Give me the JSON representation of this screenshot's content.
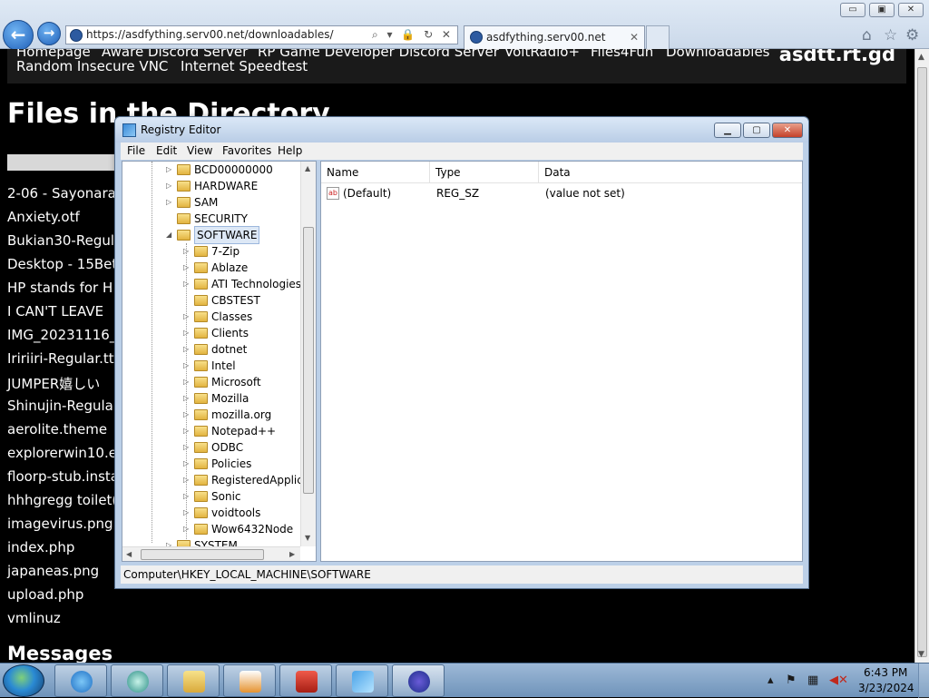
{
  "browser": {
    "url": "https://asdfything.serv00.net/downloadables/",
    "tab_title": "asdfything.serv00.net",
    "window_controls": {
      "minimize": "▭",
      "maximize": "▣",
      "close": "✕"
    },
    "back_icon": "back-arrow-icon",
    "forward_icon": "forward-arrow-icon"
  },
  "site": {
    "nav_row1": [
      "Homepage",
      "Aware Discord Server",
      "RP Game Developer Discord Server",
      "VoltRadio+",
      "Files4Fun",
      "Downloadables"
    ],
    "nav_row2": [
      "Random Insecure VNC",
      "Internet Speedtest"
    ],
    "brand": "asdtt.rt.gd",
    "heading": "Files in the Directory",
    "files": [
      "2-06 - Sayonara",
      "Anxiety.otf",
      "Bukian30-Regula",
      "Desktop - 15Bett",
      "HP stands for H",
      "I CAN'T LEAVE",
      "IMG_20231116_1",
      "Iririiri-Regular.tt",
      "JUMPER嬉しい",
      "Shinujin-Regular",
      "aerolite.theme",
      "explorerwin10.ex",
      "floorp-stub.insta",
      "hhhgregg toilet(",
      "imagevirus.png",
      "index.php",
      "japaneas.png",
      "upload.php",
      "vmlinuz"
    ],
    "messages_heading": "Messages"
  },
  "regedit": {
    "title": "Registry Editor",
    "menu": [
      "File",
      "Edit",
      "View",
      "Favorites",
      "Help"
    ],
    "tree_root": [
      "BCD00000000",
      "HARDWARE",
      "SAM",
      "SECURITY",
      "SOFTWARE"
    ],
    "tree_children": [
      "7-Zip",
      "Ablaze",
      "ATI Technologies",
      "CBSTEST",
      "Classes",
      "Clients",
      "dotnet",
      "Intel",
      "Microsoft",
      "Mozilla",
      "mozilla.org",
      "Notepad++",
      "ODBC",
      "Policies",
      "RegisteredApplica",
      "Sonic",
      "voidtools",
      "Wow6432Node"
    ],
    "tree_after": "SYSTEM",
    "selected": "SOFTWARE",
    "columns": [
      "Name",
      "Type",
      "Data"
    ],
    "values": [
      {
        "name": "(Default)",
        "type": "REG_SZ",
        "data": "(value not set)",
        "icon": "string-value-icon"
      }
    ],
    "status": "Computer\\HKEY_LOCAL_MACHINE\\SOFTWARE"
  },
  "taskbar": {
    "apps": [
      "internet-explorer-icon",
      "media-player-icon",
      "file-explorer-icon",
      "media-center-icon",
      "toolbox-icon",
      "registry-editor-icon",
      "browser-icon"
    ],
    "time": "6:43 PM",
    "date": "3/23/2024"
  }
}
